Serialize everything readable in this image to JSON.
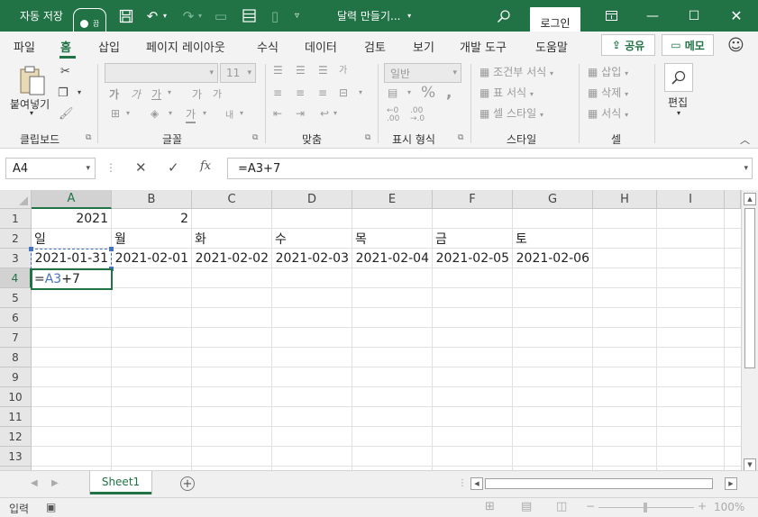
{
  "titlebar": {
    "autosave_label": "자동 저장",
    "autosave_state": "끔",
    "document_title": "달력 만들기...",
    "login_label": "로그인"
  },
  "tabs": [
    "파일",
    "홈",
    "삽입",
    "페이지 레이아웃",
    "수식",
    "데이터",
    "검토",
    "보기",
    "개발 도구",
    "도움말"
  ],
  "active_tab": "홈",
  "share_label": "공유",
  "memo_label": "메모",
  "ribbon": {
    "groups": [
      "클립보드",
      "글꼴",
      "맞춤",
      "표시 형식",
      "스타일",
      "셀",
      "편집"
    ],
    "paste_label": "붙여넣기",
    "font_size": "11",
    "number_format": "일반",
    "style_items": [
      "조건부 서식",
      "표 서식",
      "셀 스타일"
    ],
    "cell_items": [
      "삽입",
      "삭제",
      "서식"
    ],
    "font_buttons": [
      "가",
      "가",
      "가",
      "가",
      "가",
      "내",
      "가"
    ],
    "align_glyph": "가"
  },
  "formula_bar": {
    "name_box": "A4",
    "formula": "=A3+7"
  },
  "grid": {
    "columns": [
      "A",
      "B",
      "C",
      "D",
      "E",
      "F",
      "G",
      "H",
      "I"
    ],
    "rows": [
      "1",
      "2",
      "3",
      "4",
      "5",
      "6",
      "7",
      "8",
      "9",
      "10",
      "11",
      "12",
      "13"
    ],
    "selected_column": "A",
    "selected_row": "4",
    "cells": {
      "A1": "2021",
      "B1": "2",
      "A2": "일",
      "B2": "월",
      "C2": "화",
      "D2": "수",
      "E2": "목",
      "F2": "금",
      "G2": "토",
      "A3": "2021-01-31",
      "B3": "2021-02-01",
      "C3": "2021-02-02",
      "D3": "2021-02-03",
      "E3": "2021-02-04",
      "F3": "2021-02-05",
      "G3": "2021-02-06"
    },
    "active_cell_editing": {
      "prefix": "=",
      "ref": "A3",
      "suffix": "+7"
    }
  },
  "sheets": [
    "Sheet1"
  ],
  "status": {
    "mode": "입력",
    "zoom": "100%"
  },
  "colors": {
    "accent": "#217346",
    "reference": "#4472c4"
  }
}
